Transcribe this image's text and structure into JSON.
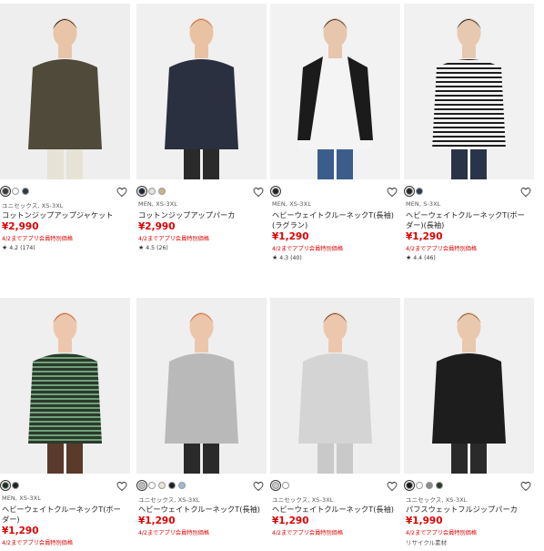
{
  "products": [
    {
      "swatches": [
        "#3b3b3b",
        "#ffffff",
        "#2d3a4a"
      ],
      "meta": "ユニセックス, XS-3XL",
      "name": "コットンジップアップジャケット",
      "price": "¥2,990",
      "promo": "4/2までアプリ会員特別価格",
      "rating": "4.2 (174)",
      "colors": {
        "bg": "#eeeeee",
        "top": "#4f4a3a",
        "bottom": "#e6e2d6",
        "skin": "#e8c4a8",
        "hair": "#1f1f1f"
      }
    },
    {
      "swatches": [
        "#1f2633",
        "#e5e2d8",
        "#c8b48c"
      ],
      "meta": "MEN, XS-3XL",
      "name": "コットンジップアップパーカ",
      "price": "¥2,990",
      "promo": "4/2までアプリ会員特別価格",
      "rating": "4.5 (26)",
      "colors": {
        "bg": "#f0f0f0",
        "top": "#2a3040",
        "bottom": "#2a2a2a",
        "skin": "#e9c2a4",
        "hair": "#c46a3c"
      }
    },
    {
      "swatches": [
        "#222222"
      ],
      "meta": "MEN, XS-3XL",
      "name": "ヘビーウェイトクルーネックT(長袖)(ラグラン)",
      "price": "¥1,290",
      "promo": "4/2までアプリ会員特別価格",
      "rating": "4.3 (40)",
      "colors": {
        "bg": "#f2f2f2",
        "top": "#f4f4f4",
        "bottom": "#3b5d8c",
        "skin": "#e6c6ad",
        "hair": "#3a2a20"
      }
    },
    {
      "swatches": [
        "#262626",
        "#2b3a55"
      ],
      "meta": "MEN, S-3XL",
      "name": "ヘビーウェイトクルーネックT(ボーダー)(長袖)",
      "price": "¥1,290",
      "promo": "4/2までアプリ会員特別価格",
      "rating": "4.4 (46)",
      "colors": {
        "bg": "#f1f1f1",
        "top": "#2a2a2a",
        "bottom": "#2a3448",
        "skin": "#e7c8b0",
        "hair": "#1c1c1c"
      }
    },
    {
      "swatches": [
        "#1c3322",
        "#222222"
      ],
      "meta": "MEN, XS-3XL",
      "name": "ヘビーウェイトクルーネックT(ボーダー)",
      "price": "¥1,290",
      "promo": "4/2までアプリ会員特別価格",
      "rating": "",
      "colors": {
        "bg": "#efefef",
        "top": "#2c4a38",
        "bottom": "#5a3a2a",
        "skin": "#edc7ad",
        "hair": "#c05a2a"
      }
    },
    {
      "swatches": [
        "#bcbcbc",
        "#ffffff",
        "#e9e4d6",
        "#1f1f1f",
        "#9fb8d8"
      ],
      "meta": "ユニセックス, XS-3XL",
      "name": "ヘビーウェイトクルーネックT(長袖)",
      "price": "¥1,290",
      "promo": "4/2までアプリ会員特別価格",
      "rating": "",
      "colors": {
        "bg": "#efefef",
        "top": "#b9b9b9",
        "bottom": "#2a2a2a",
        "skin": "#ecc6aa",
        "hair": "#c9683a"
      }
    },
    {
      "swatches": [
        "#c8c8c8",
        "#ffffff"
      ],
      "meta": "ユニセックス, XS-3XL",
      "name": "ヘビーウェイトクルーネックT(長袖)",
      "price": "¥1,290",
      "promo": "4/2までアプリ会員特別価格",
      "rating": "",
      "colors": {
        "bg": "#eeeeee",
        "top": "#d4d4d4",
        "bottom": "#c9c9c9",
        "skin": "#ecc7ad",
        "hair": "#6a4428"
      }
    },
    {
      "swatches": [
        "#1a1a1a",
        "#ffffff",
        "#8a8a8a",
        "#2e3a30"
      ],
      "meta": "ユニセックス, XS-3XL",
      "name": "パフスウェットフルジップパーカ",
      "price": "¥1,990",
      "promo": "4/2までアプリ会員特別価格",
      "note": "リサイクル素材",
      "rating": "",
      "colors": {
        "bg": "#f0f0f0",
        "top": "#1d1d1d",
        "bottom": "#2a2a2a",
        "skin": "#e9c8ae",
        "hair": "#8a5a30"
      }
    }
  ]
}
